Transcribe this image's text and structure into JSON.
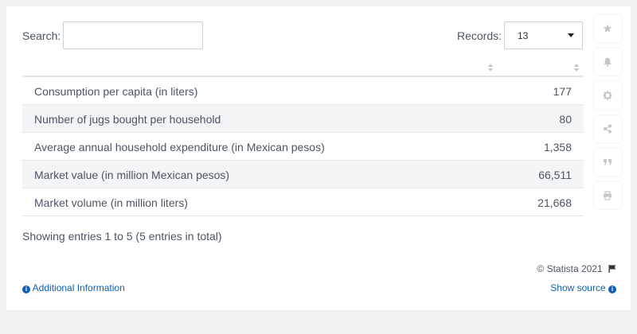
{
  "search": {
    "label": "Search:",
    "value": "",
    "placeholder": ""
  },
  "records": {
    "label": "Records:",
    "value": "13"
  },
  "table": {
    "rows": [
      {
        "label": "Consumption per capita (in liters)",
        "value": "177"
      },
      {
        "label": "Number of jugs bought per household",
        "value": "80"
      },
      {
        "label": "Average annual household expenditure (in Mexican pesos)",
        "value": "1,358"
      },
      {
        "label": "Market value (in million Mexican pesos)",
        "value": "66,511"
      },
      {
        "label": "Market volume (in million liters)",
        "value": "21,668"
      }
    ]
  },
  "footer": {
    "entries_info": "Showing entries 1 to 5 (5 entries in total)",
    "copyright": "© Statista 2021",
    "additional_info": "Additional Information",
    "show_source": "Show source"
  },
  "sidebar_icons": [
    "star-icon",
    "bell-icon",
    "gear-icon",
    "share-icon",
    "quote-icon",
    "print-icon"
  ],
  "colors": {
    "link": "#0f5fb4",
    "row_alt": "#f3f4f6",
    "icon": "#c4c8cc"
  }
}
